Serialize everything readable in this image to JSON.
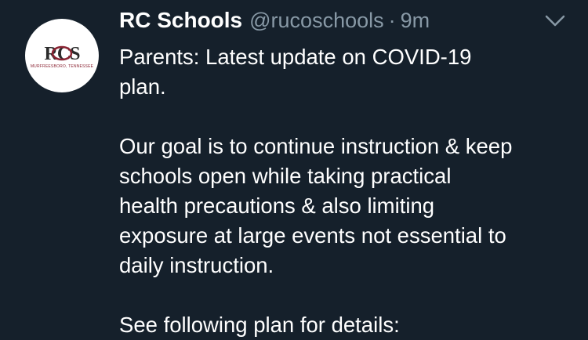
{
  "tweet": {
    "author": {
      "display_name": "RC Schools",
      "handle": "@rucoschools",
      "avatar": {
        "logo_text": "RCS",
        "tagline": "MURFREESBORO, TENNESSEE",
        "colors": {
          "primary": "#8a2332",
          "dark": "#2b2b2b",
          "background": "#ffffff"
        }
      }
    },
    "separator": "·",
    "timestamp": "9m",
    "menu_icon": "chevron-down-icon",
    "lines": {
      "line1": "Parents: Latest update on COVID-19",
      "line2": "plan.",
      "line3": "Our goal is to continue instruction & keep",
      "line4": "schools open while taking practical",
      "line5": "health precautions & also limiting",
      "line6": "exposure at large events not essential to",
      "line7": "daily instruction.",
      "line8": "See following plan for details:"
    }
  },
  "theme": {
    "background": "#15202b",
    "text": "#ffffff",
    "secondary_text": "#8899a6"
  }
}
